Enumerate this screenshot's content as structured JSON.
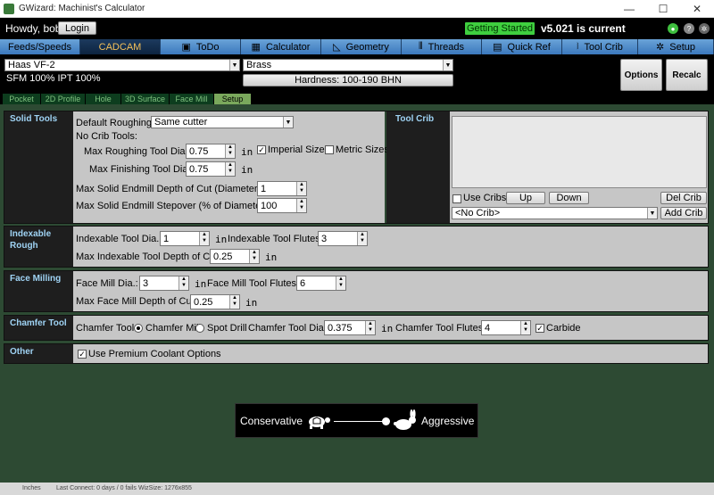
{
  "window": {
    "title": "GWizard: Machinist's Calculator",
    "minimize": "—",
    "maximize": "☐",
    "close": "✕"
  },
  "topbar": {
    "greeting": "Howdy, bob!",
    "login_label": "Login",
    "getting_started": "Getting Started",
    "version_text": "v5.021 is current",
    "icon1": "status-icon",
    "icon2": "tip-icon",
    "icon3": "gear-icon",
    "help_glyph": "?"
  },
  "tabs": [
    {
      "label": "Feeds/Speeds",
      "icon": ""
    },
    {
      "label": "CADCAM",
      "icon": ""
    },
    {
      "label": "ToDo",
      "icon": "▣"
    },
    {
      "label": "Calculator",
      "icon": "▦"
    },
    {
      "label": "Geometry",
      "icon": "◺"
    },
    {
      "label": "Threads",
      "icon": "⫴"
    },
    {
      "label": "Quick Ref",
      "icon": "▤"
    },
    {
      "label": "Tool Crib",
      "icon": "⧘"
    },
    {
      "label": "Setup",
      "icon": "✲"
    }
  ],
  "machine": {
    "selected": "Haas VF-2",
    "sfm_ipt": "SFM 100% IPT 100%",
    "material": "Brass",
    "hardness": "Hardness: 100-190 BHN",
    "options_label": "Options",
    "recalc_label": "Recalc"
  },
  "subtabs": [
    "Pocket",
    "2D Profile",
    "Hole",
    "3D Surface",
    "Face Mill",
    "Setup"
  ],
  "solid_tools": {
    "label": "Solid Tools",
    "default_roughing_label": "Default Roughing:",
    "default_roughing_value": "Same cutter",
    "no_crib_label": "No Crib Tools:",
    "max_rough_label": "Max Roughing Tool Dia.:",
    "max_rough_value": "0.75",
    "max_finish_label": "Max Finishing Tool Dia.:",
    "max_finish_value": "0.75",
    "unit": "in",
    "imperial_label": "Imperial Sizes",
    "metric_label": "Metric Sizes",
    "depth_label": "Max Solid Endmill Depth of Cut (Diameters):",
    "depth_value": "1",
    "stepover_label": "Max Solid Endmill Stepover (% of Diameter):",
    "stepover_value": "100"
  },
  "tool_crib": {
    "label": "Tool Crib",
    "use_cribs_label": "Use Cribs:",
    "up_label": "Up",
    "down_label": "Down",
    "del_label": "Del Crib",
    "crib_select": "<No Crib>",
    "add_label": "Add Crib"
  },
  "indexable": {
    "label": "Indexable Rough",
    "dia_label": "Indexable Tool Dia.:",
    "dia_value": "1",
    "flutes_label": "Indexable Tool Flutes:",
    "flutes_value": "3",
    "depth_label": "Max Indexable Tool Depth of Cut:",
    "depth_value": "0.25",
    "unit": "in"
  },
  "face_milling": {
    "label": "Face Milling",
    "dia_label": "Face Mill Dia.:",
    "dia_value": "3",
    "flutes_label": "Face Mill Tool Flutes:",
    "flutes_value": "6",
    "depth_label": "Max Face Mill Depth of Cut:",
    "depth_value": "0.25",
    "unit": "in"
  },
  "chamfer": {
    "label": "Chamfer Tool",
    "tool_label": "Chamfer Tool:",
    "opt1": "Chamfer Mill",
    "opt2": "Spot Drill",
    "dia_label": "Chamfer Tool Dia.:",
    "dia_value": "0.375",
    "unit": "in",
    "flutes_label": "Chamfer Tool Flutes:",
    "flutes_value": "4",
    "carbide_label": "Carbide"
  },
  "other": {
    "label": "Other",
    "coolant_label": "Use Premium Coolant Options"
  },
  "slider": {
    "left_label": "Conservative",
    "right_label": "Aggressive",
    "position": 0.5
  },
  "status": {
    "units": "Inches",
    "last_connect": "Last Connect: 0 days / 0 fails",
    "wizsize": "WizSize: 1276x855"
  }
}
